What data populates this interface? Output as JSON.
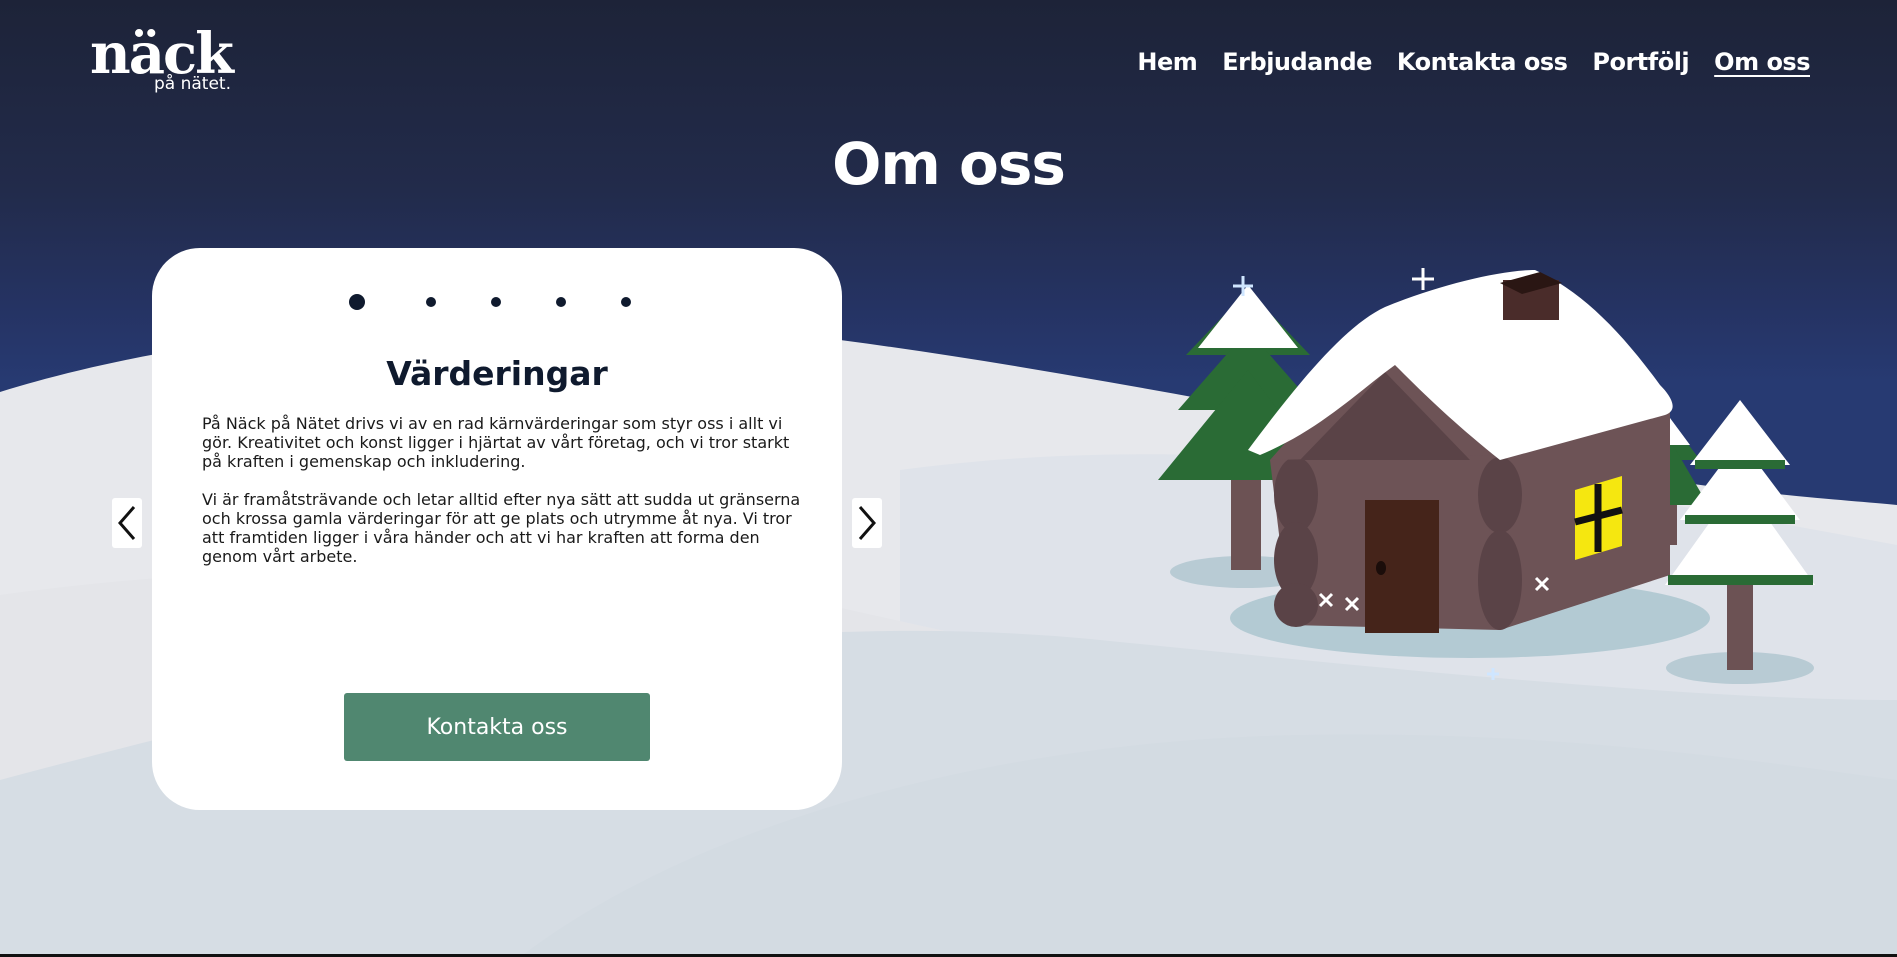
{
  "logo": {
    "main": "näck",
    "sub": "på nätet."
  },
  "nav": {
    "items": [
      {
        "label": "Hem"
      },
      {
        "label": "Erbjudande"
      },
      {
        "label": "Kontakta oss"
      },
      {
        "label": "Portfölj"
      },
      {
        "label": "Om oss"
      }
    ]
  },
  "page": {
    "title": "Om oss"
  },
  "carousel": {
    "slide_count": 5,
    "active_slide": 1,
    "title": "Värderingar",
    "paragraphs": [
      "På Näck på Nätet drivs vi av en rad kärnvärderingar som styr oss i allt vi gör. Kreativitet och konst ligger i hjärtat av vårt företag, och vi tror starkt på kraften i gemenskap och inkludering.",
      "Vi är framåtsträvande och letar alltid efter nya sätt att sudda ut gränserna och krossa gamla värderingar för att ge plats och utrymme åt nya. Vi tror att framtiden ligger i våra händer och att vi har kraften att forma den genom vårt arbete."
    ],
    "cta_label": "Kontakta oss",
    "prev_icon": "chevron-left-icon",
    "next_icon": "chevron-right-icon"
  },
  "colors": {
    "sky_top": "#1d2338",
    "sky_bottom": "#273a72",
    "snow": "#e6e8ec",
    "cta": "#508770",
    "title_dark": "#0f1a2e"
  }
}
